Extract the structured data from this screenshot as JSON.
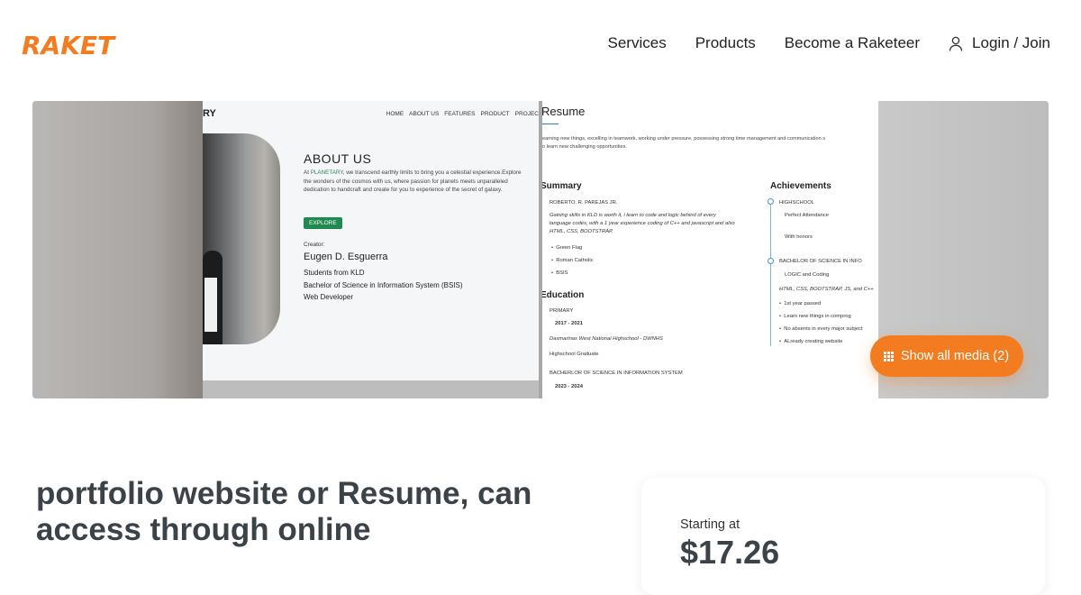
{
  "brand": {
    "logo_text": "RAKET",
    "accent_color": "#f47c20"
  },
  "nav": {
    "items": [
      "Services",
      "Products",
      "Become a Raketeer"
    ],
    "login_label": "Login / Join",
    "login_icon": "user-icon"
  },
  "gallery": {
    "show_media_label": "Show all media (2)",
    "show_media_icon": "grid-icon",
    "shot1": {
      "brand_fragment": "RY",
      "menu": [
        "HOME",
        "ABOUT US",
        "FEATURES",
        "PRODUCT",
        "PROJEC"
      ],
      "heading": "ABOUT US",
      "para_prefix": "At ",
      "para_accent": "PLANETARY",
      "para_rest": ", we transcend earthly limits to bring you a celestial experience.Explore the wonders of the cosmos with us, where passion for planets meets unparalleled dedication to handcraft and create for you to experience of the secret of galaxy.",
      "button": "EXPLORE",
      "creator_label": "Creator:",
      "creator_name": "Eugen D. Esguerra",
      "creator_lines": [
        "Students from KLD",
        "Bachelor of Science in Information System (BSIS)",
        "Web Developer"
      ]
    },
    "shot2": {
      "title": "Resume",
      "intro_line1": "earning new things, excelling in teamwork, working under pressure, possessing strong time management and communication s",
      "intro_line2": "o learn new challenging opportunities.",
      "summary_h": "Summary",
      "summary_name": "ROBERTO. R. PAREJAS JR.",
      "summary_text1": "Gaining skills in KLD is worth it, i learn to code and logic behind of every",
      "summary_text2": "language codes, with a 1 year experience coding of C++ and javascript and also",
      "summary_text3": "HTML, CSS, BOOTSTRAP.",
      "summary_bullets": [
        "Green Flag",
        "Roman Catholic",
        "BSIS"
      ],
      "education_h": "Education",
      "edu_primary": "PRIMARY",
      "edu_primary_years": "2017 - 2021",
      "edu_school": "Dasmarinas West National Highschool - DWNHS",
      "edu_status": "Highschool Graduate",
      "edu_college": "BACHERLOR OF SCIENCE IN INFORMATION SYSTEM",
      "edu_college_years": "2023 - 2024",
      "achievements_h": "Achievements",
      "ach_hs": "HIGHSCHOOL",
      "ach_hs_1": "Perfect Attendance",
      "ach_hs_2": "With honors",
      "ach_bs": "BACHELOR OF SCIENCE IN INFO",
      "ach_bs_sub": "LOGIC and Coding",
      "ach_bs_skills": "HTML, CSS, BOOTSTRAP, JS, and C++",
      "ach_bullets": [
        "1st year passed",
        "Learn new things in comprog",
        "No absents in every major subject",
        "ALready creating website"
      ]
    }
  },
  "listing": {
    "title": "portfolio website or Resume, can access through online",
    "starting_label": "Starting at",
    "price": "$17.26"
  }
}
